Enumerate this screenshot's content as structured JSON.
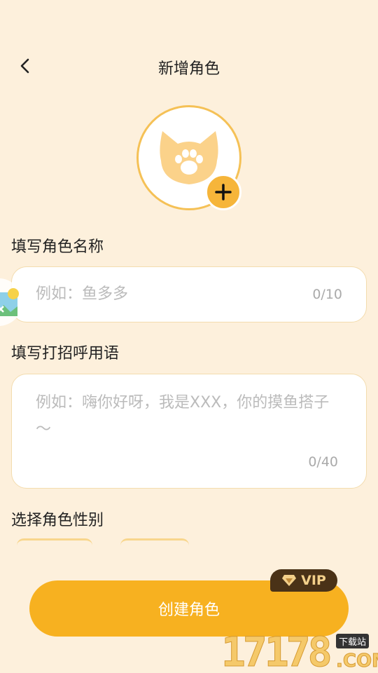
{
  "header": {
    "title": "新增角色"
  },
  "avatar": {
    "icon": "cat-paw-icon",
    "add_icon": "plus-icon"
  },
  "name_section": {
    "label": "填写角色名称",
    "placeholder": "例如：鱼多多",
    "counter": "0/10"
  },
  "greeting_section": {
    "label": "填写打招呼用语",
    "placeholder": "例如：嗨你好呀，我是XXX，你的摸鱼搭子～",
    "counter": "0/40"
  },
  "gender_section": {
    "label": "选择角色性别"
  },
  "create_button": {
    "label": "创建角色",
    "badge": "VIP"
  },
  "watermark": {
    "digits": "17178",
    "tag": "下载站",
    "suffix": ".COM"
  },
  "colors": {
    "accent": "#f7b120",
    "background": "#fdf0dc",
    "vip_bg": "#4a3217"
  }
}
